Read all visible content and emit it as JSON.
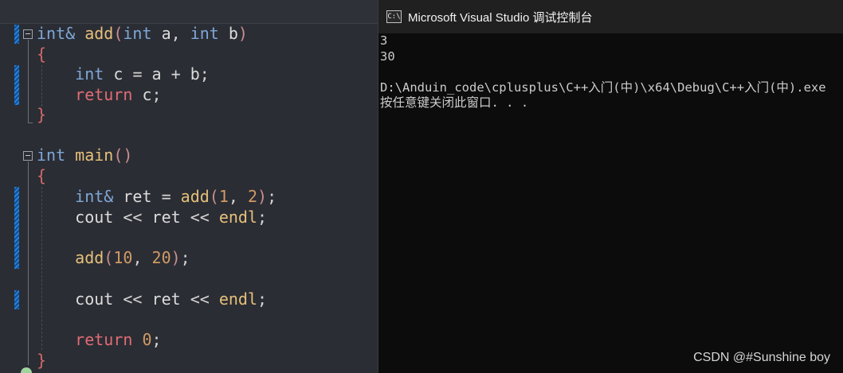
{
  "editor": {
    "lines": {
      "add_sig": {
        "type": "int&",
        "name": "add",
        "open": "(",
        "p1_type": "int",
        "p1": "a",
        "comma": ",",
        "p2_type": "int",
        "p2": "b",
        "close": ")"
      },
      "brace_open_1": "{",
      "add_body_1": {
        "type": "int",
        "var": "c",
        "eq": "=",
        "a": "a",
        "plus": "+",
        "b": "b",
        "semi": ";"
      },
      "add_body_2": {
        "kw": "return",
        "var": "c",
        "semi": ";"
      },
      "brace_close_1": "}",
      "main_sig": {
        "type": "int",
        "name": "main",
        "parens": "()"
      },
      "brace_open_2": "{",
      "main_1": {
        "type": "int&",
        "var": "ret",
        "eq": "=",
        "fn": "add",
        "open": "(",
        "n1": "1",
        "comma": ",",
        "n2": "2",
        "close": ")",
        "semi": ";"
      },
      "main_2": {
        "cout": "cout",
        "op1": "<<",
        "var": "ret",
        "op2": "<<",
        "endl": "endl",
        "semi": ";"
      },
      "main_3": {
        "fn": "add",
        "open": "(",
        "n1": "10",
        "comma": ",",
        "n2": "20",
        "close": ")",
        "semi": ";"
      },
      "main_4": {
        "cout": "cout",
        "op1": "<<",
        "var": "ret",
        "op2": "<<",
        "endl": "endl",
        "semi": ";"
      },
      "main_5": {
        "kw": "return",
        "n": "0",
        "semi": ";"
      },
      "brace_close_2": "}"
    }
  },
  "console": {
    "title": "Microsoft Visual Studio 调试控制台",
    "icon_label": "C:\\",
    "output": [
      "3",
      "30",
      "",
      "D:\\Anduin_code\\cplusplus\\C++入门(中)\\x64\\Debug\\C++入门(中).exe",
      "按任意键关闭此窗口. . ."
    ]
  },
  "watermark": "CSDN @#Sunshine boy",
  "colors": {
    "editor_bg": "#2b2d34",
    "console_bg": "#0c0c0c",
    "titlebar_bg": "#202020",
    "keyword": "#7ea7d8",
    "return_keyword": "#e06c75",
    "function": "#e5c07b",
    "number": "#d19a66",
    "change_bar": "#1e82e6"
  }
}
